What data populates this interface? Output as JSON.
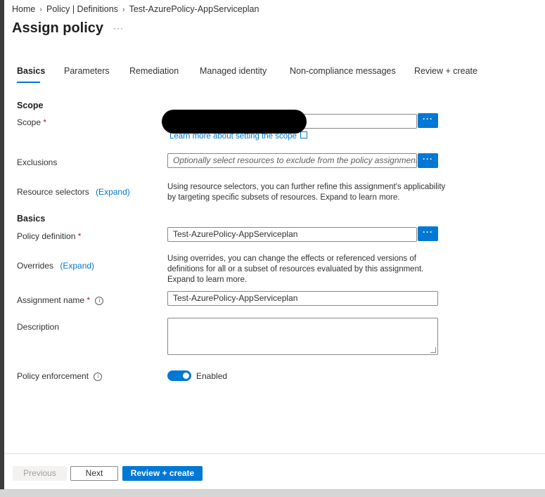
{
  "breadcrumb": {
    "items": [
      "Home",
      "Policy | Definitions",
      "Test-AzurePolicy-AppServiceplan"
    ],
    "separator": "›"
  },
  "header": {
    "title": "Assign policy",
    "more": "···"
  },
  "tabs": [
    {
      "label": "Basics",
      "active": true
    },
    {
      "label": "Parameters"
    },
    {
      "label": "Remediation"
    },
    {
      "label": "Managed identity"
    },
    {
      "label": "Non-compliance messages"
    },
    {
      "label": "Review + create"
    }
  ],
  "form": {
    "scope_section": "Scope",
    "scope_label": "Scope",
    "required_mark": "*",
    "scope_button": "···",
    "scope_link": "Learn more about setting the scope",
    "exclusions_label": "Exclusions",
    "exclusions_placeholder": "Optionally select resources to exclude from the policy assignment.",
    "exclusions_button": "···",
    "resource_selectors_label": "Resource selectors",
    "expand_label": "(Expand)",
    "resource_selectors_text_1": "Using resource selectors, you can further refine this assignment's applicability",
    "resource_selectors_text_2": "by targeting specific subsets of resources. Expand to learn more.",
    "basics_section": "Basics",
    "policy_definition_label": "Policy definition",
    "policy_definition_value": "Test-AzurePolicy-AppServiceplan",
    "policy_definition_button": "···",
    "overrides_label": "Overrides",
    "overrides_text_1": "Using overrides, you can change the effects or referenced versions of",
    "overrides_text_2": "definitions for all or a subset of resources evaluated by this assignment.",
    "overrides_text_3": "Expand to learn more.",
    "assignment_name_label": "Assignment name",
    "assignment_name_value": "Test-AzurePolicy-AppServiceplan",
    "description_label": "Description",
    "description_value": "",
    "policy_enforcement_label": "Policy enforcement",
    "policy_enforcement_value": "Enabled",
    "info_glyph": "i"
  },
  "footer": {
    "previous": "Previous",
    "next": "Next",
    "review_create": "Review + create"
  },
  "colors": {
    "accent": "#0078d4",
    "required": "#a4262c"
  }
}
